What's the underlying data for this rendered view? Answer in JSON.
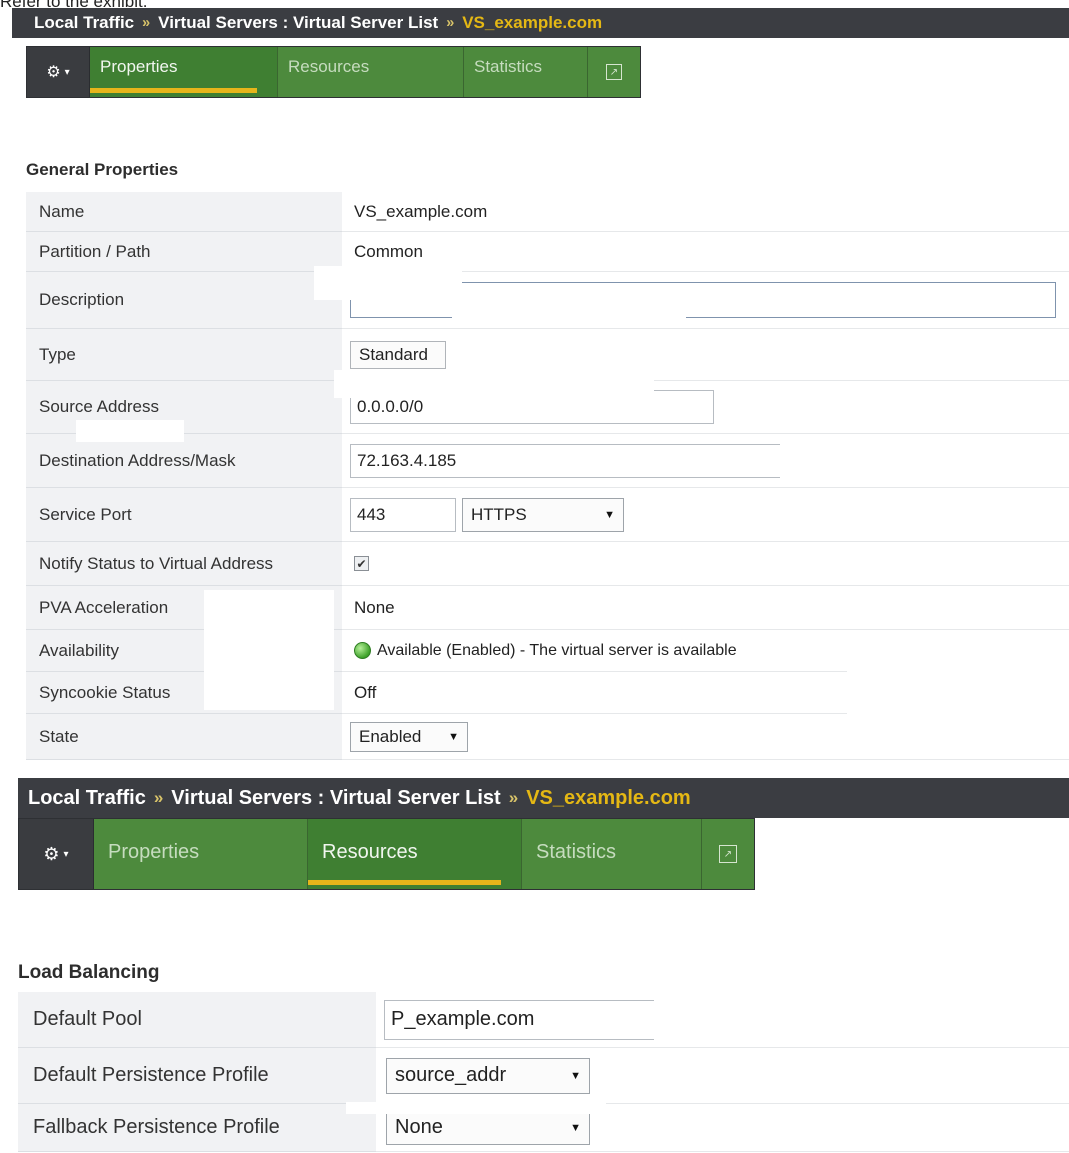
{
  "caption": "Refer to the exhibit.",
  "panel1": {
    "breadcrumb": {
      "part1": "Local Traffic",
      "sep": "»",
      "part2": "Virtual Servers : Virtual Server List",
      "current": "VS_example.com"
    },
    "tabs": [
      {
        "label": "Properties",
        "active": true
      },
      {
        "label": "Resources",
        "active": false
      },
      {
        "label": "Statistics",
        "active": false
      }
    ],
    "gear_icon": "gear-icon",
    "section_title": "General Properties",
    "rows": {
      "name": {
        "label": "Name",
        "value": "VS_example.com"
      },
      "partition": {
        "label": "Partition / Path",
        "value": "Common"
      },
      "description": {
        "label": "Description",
        "value": ""
      },
      "type": {
        "label": "Type",
        "value": "Standard"
      },
      "source": {
        "label": "Source Address",
        "value": "0.0.0.0/0"
      },
      "destination": {
        "label": "Destination Address/Mask",
        "value": "72.163.4.185"
      },
      "service_port": {
        "label": "Service Port",
        "value": "443",
        "protocol": "HTTPS"
      },
      "notify": {
        "label": "Notify Status to Virtual Address",
        "checked": true,
        "check_glyph": "✔"
      },
      "pva": {
        "label": "PVA Acceleration",
        "value": "None"
      },
      "availability": {
        "label": "Availability",
        "value": "Available (Enabled) - The virtual server is available",
        "status_color": "#3fa22b"
      },
      "syncookie": {
        "label": "Syncookie Status",
        "value": "Off"
      },
      "state": {
        "label": "State",
        "value": "Enabled"
      }
    }
  },
  "panel2": {
    "breadcrumb": {
      "part1": "Local Traffic",
      "sep": "»",
      "part2": "Virtual Servers : Virtual Server List",
      "current": "VS_example.com"
    },
    "tabs": [
      {
        "label": "Properties",
        "active": false
      },
      {
        "label": "Resources",
        "active": true
      },
      {
        "label": "Statistics",
        "active": false
      }
    ],
    "section_title": "Load Balancing",
    "rows": {
      "default_pool": {
        "label": "Default Pool",
        "value": "P_example.com"
      },
      "persistence": {
        "label": "Default Persistence Profile",
        "value": "source_addr"
      },
      "fallback": {
        "label": "Fallback Persistence Profile",
        "value": "None"
      }
    }
  },
  "colors": {
    "breadcrumb_bg": "#3b3d42",
    "breadcrumb_current": "#e5b814",
    "tab_green": "#4d8a3d",
    "tab_active_underline": "#e6b51a"
  }
}
